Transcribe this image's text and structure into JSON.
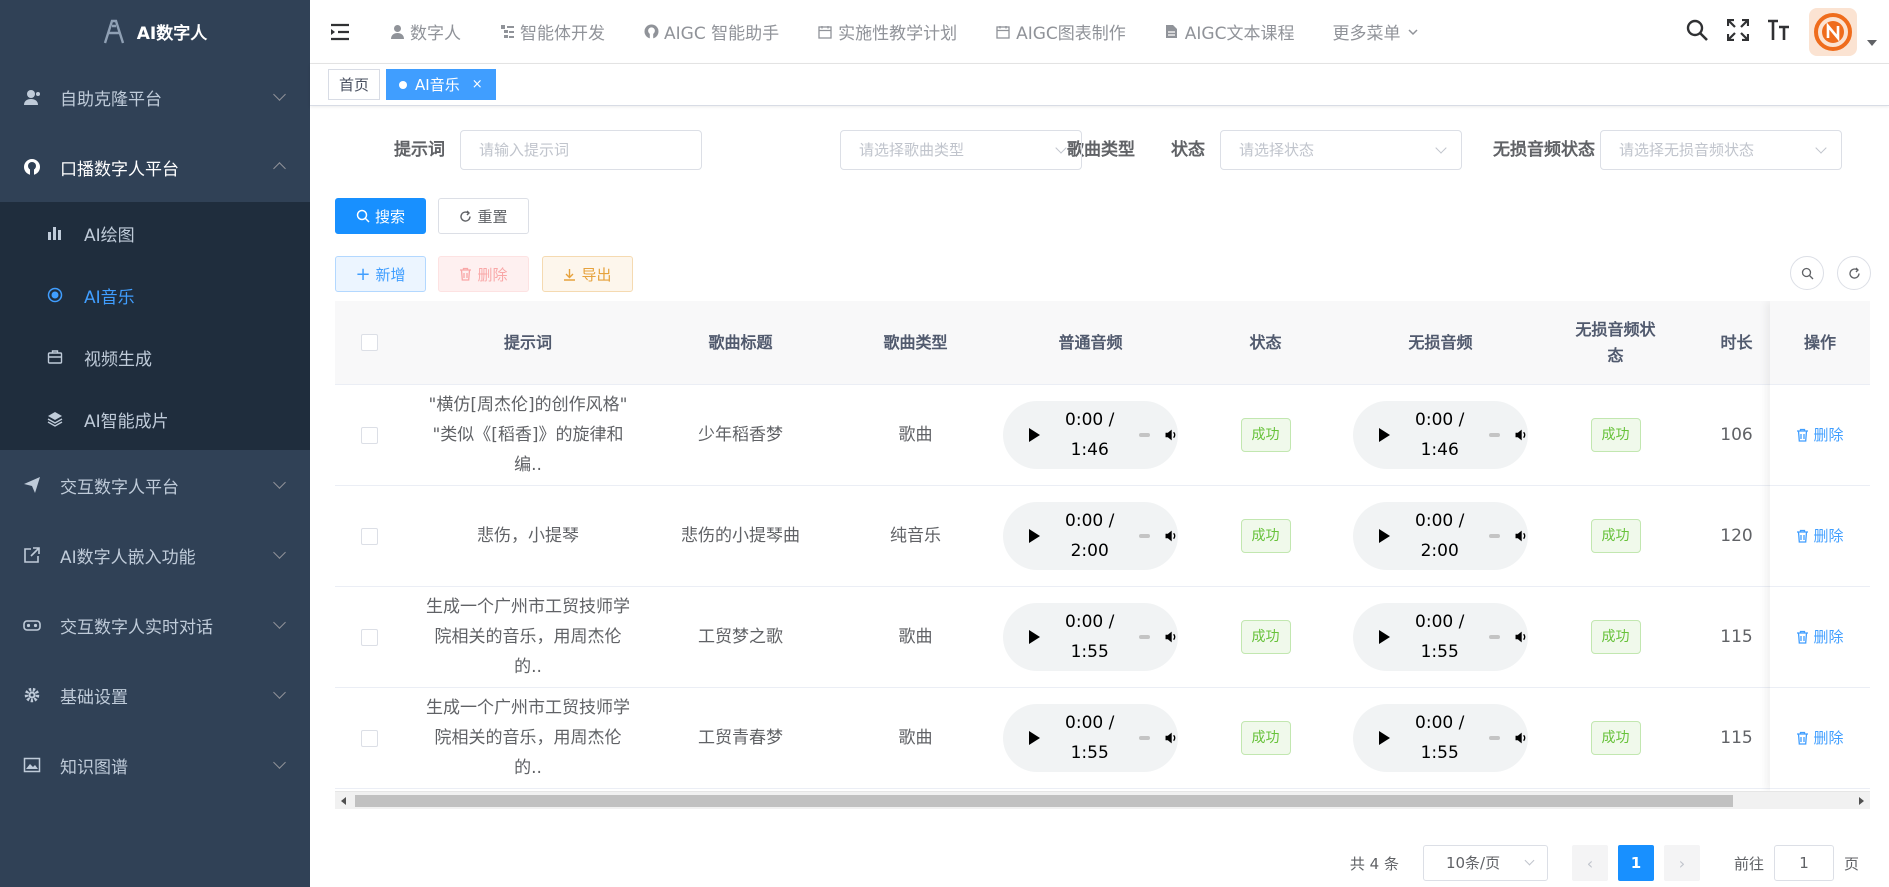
{
  "app": {
    "title": "AI数字人"
  },
  "sidebar": {
    "menus": [
      {
        "label": "自助克隆平台"
      },
      {
        "label": "口播数字人平台"
      },
      {
        "label": "交互数字人平台"
      },
      {
        "label": "AI数字人嵌入功能"
      },
      {
        "label": "交互数字人实时对话"
      },
      {
        "label": "基础设置"
      },
      {
        "label": "知识图谱"
      }
    ],
    "submenu": [
      {
        "label": "AI绘图"
      },
      {
        "label": "AI音乐"
      },
      {
        "label": "视频生成"
      },
      {
        "label": "AI智能成片"
      }
    ]
  },
  "topnav": {
    "items": [
      "数字人",
      "智能体开发",
      "AIGC 智能助手",
      "实施性教学计划",
      "AIGC图表制作",
      "AIGC文本课程",
      "更多菜单"
    ]
  },
  "tags": {
    "home": "首页",
    "current": "AI音乐",
    "close": "×"
  },
  "filters": {
    "prompt_label": "提示词",
    "prompt_placeholder": "请输入提示词",
    "type_label": "歌曲类型",
    "type_placeholder": "请选择歌曲类型",
    "status_label": "状态",
    "status_placeholder": "请选择状态",
    "lossless_label": "无损音频状态",
    "lossless_placeholder": "请选择无损音频状态"
  },
  "actions": {
    "search": "搜索",
    "reset": "重置",
    "add": "新增",
    "delete": "删除",
    "export": "导出"
  },
  "table": {
    "headers": [
      "提示词",
      "歌曲标题",
      "歌曲类型",
      "普通音频",
      "状态",
      "无损音频",
      "无损音频状态",
      "时长",
      "操作"
    ],
    "rows": [
      {
        "prompt": "\"横仿[周杰伦]的创作风格\" \"类似《[稻香]》的旋律和编..",
        "title": "少年稻香梦",
        "type": "歌曲",
        "audio": "0:00 / 1:46",
        "status": "成功",
        "lossless_audio": "0:00 / 1:46",
        "lossless_status": "成功",
        "duration": "106",
        "op": "删除"
      },
      {
        "prompt": "悲伤，小提琴",
        "title": "悲伤的小提琴曲",
        "type": "纯音乐",
        "audio": "0:00 / 2:00",
        "status": "成功",
        "lossless_audio": "0:00 / 2:00",
        "lossless_status": "成功",
        "duration": "120",
        "op": "删除"
      },
      {
        "prompt": "生成一个广州市工贸技师学院相关的音乐，用周杰伦的..",
        "title": "工贸梦之歌",
        "type": "歌曲",
        "audio": "0:00 / 1:55",
        "status": "成功",
        "lossless_audio": "0:00 / 1:55",
        "lossless_status": "成功",
        "duration": "115",
        "op": "删除"
      },
      {
        "prompt": "生成一个广州市工贸技师学院相关的音乐，用周杰伦的..",
        "title": "工贸青春梦",
        "type": "歌曲",
        "audio": "0:00 / 1:55",
        "status": "成功",
        "lossless_audio": "0:00 / 1:55",
        "lossless_status": "成功",
        "duration": "115",
        "op": "删除"
      }
    ]
  },
  "pagination": {
    "total": "共 4 条",
    "page_size": "10条/页",
    "current": "1",
    "goto": "前往",
    "goto_value": "1",
    "page_unit": "页",
    "prev": "‹",
    "next": "›"
  },
  "colors": {
    "sidebar_bg": "#304156",
    "submenu_bg": "#1f2d3d",
    "primary": "#1890ff",
    "active_text": "#409eff",
    "success": "#67c23a"
  }
}
